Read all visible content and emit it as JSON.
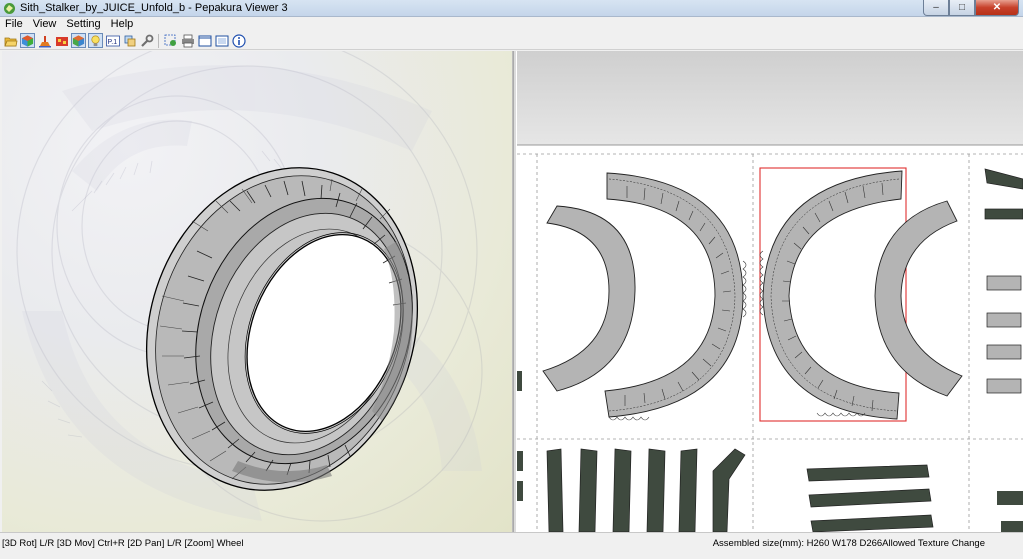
{
  "window": {
    "title": "Sith_Stalker_by_JUICE_Unfold_b - Pepakura Viewer 3",
    "app_icon": "pepakura-app-icon",
    "controls": {
      "minimize": "–",
      "maximize": "□",
      "close": "✕"
    }
  },
  "menu": {
    "items": [
      "File",
      "View",
      "Setting",
      "Help"
    ]
  },
  "toolbar": {
    "buttons": [
      {
        "name": "open-folder-icon"
      },
      {
        "name": "3d-model-icon",
        "active": true
      },
      {
        "name": "unfold-icon"
      },
      {
        "name": "texture-icon"
      },
      {
        "name": "show-faces-icon",
        "active": true
      },
      {
        "name": "lightbulb-icon",
        "active": true
      },
      {
        "name": "scale-icon",
        "label": "P.1"
      },
      {
        "name": "parts-icon"
      },
      {
        "name": "wrench-icon"
      },
      {
        "name": "select-icon"
      },
      {
        "name": "print-icon"
      },
      {
        "name": "page-layout-icon"
      },
      {
        "name": "page-settings-icon"
      },
      {
        "name": "info-icon"
      }
    ]
  },
  "status": {
    "left": "[3D Rot] L/R [3D Mov] Ctrl+R [2D Pan] L/R [Zoom] Wheel",
    "right": "Assembled size(mm): H260 W178 D266Allowed Texture Change"
  },
  "colors": {
    "part_fill": "#b4b4b4",
    "dark_part_fill": "#3f4a3f",
    "selection_border": "#e03030",
    "page_border": "#9a9a9a"
  }
}
